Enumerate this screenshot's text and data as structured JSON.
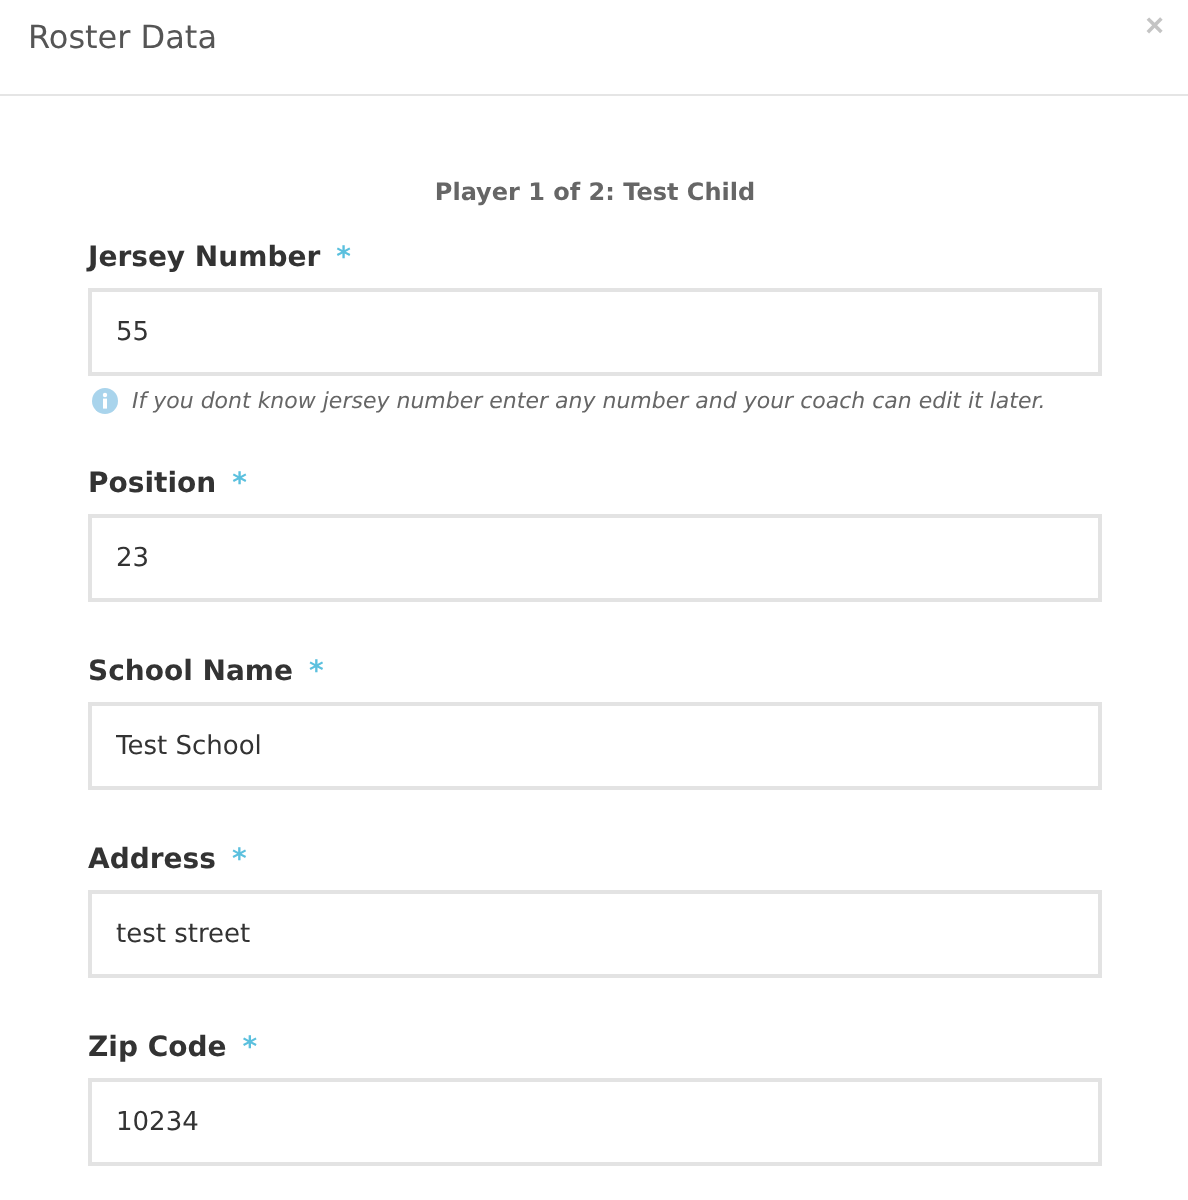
{
  "window": {
    "title": "Roster Data",
    "close": "×"
  },
  "subtitle": "Player 1 of 2: Test Child",
  "fields": [
    {
      "label": "Jersey Number",
      "required_mark": "*",
      "value": "55",
      "hint": "If you dont know jersey number enter any number and your coach can edit it later."
    },
    {
      "label": "Position",
      "required_mark": "*",
      "value": "23"
    },
    {
      "label": "School Name",
      "required_mark": "*",
      "value": "Test School"
    },
    {
      "label": "Address",
      "required_mark": "*",
      "value": "test street"
    },
    {
      "label": "Zip Code",
      "required_mark": "*",
      "value": "10234"
    }
  ]
}
